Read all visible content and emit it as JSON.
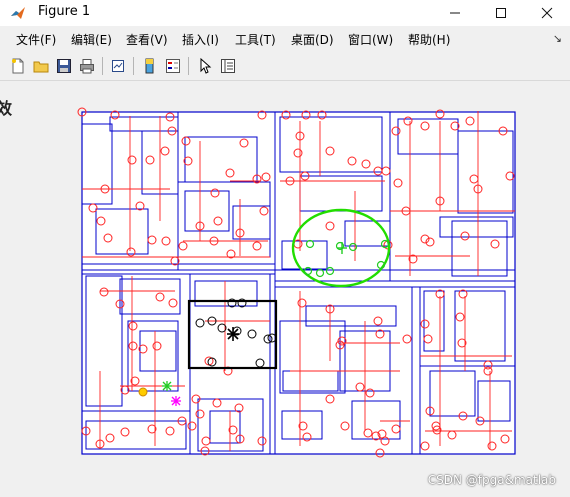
{
  "window": {
    "title": "Figure 1"
  },
  "menu": [
    "文件(F)",
    "编辑(E)",
    "查看(V)",
    "插入(I)",
    "工具(T)",
    "桌面(D)",
    "窗口(W)",
    "帮助(H)"
  ],
  "toolbar_icons": [
    "new-figure-icon",
    "open-file-icon",
    "save-icon",
    "print-icon",
    "link-plot-icon",
    "insert-colorbar-icon",
    "insert-legend-icon",
    "edit-plot-arrow-icon",
    "property-inspector-icon"
  ],
  "cut_text": "效",
  "watermark": "CSDN @fpga&matlab",
  "colors": {
    "rooms": "#0000cc",
    "links": "#ff0000",
    "highlight_box": "#000000",
    "ellipse": "#22dd00",
    "marker_green": "#22cc22",
    "marker_magenta": "#ff00ff",
    "marker_yellow": "#ffcc00"
  }
}
